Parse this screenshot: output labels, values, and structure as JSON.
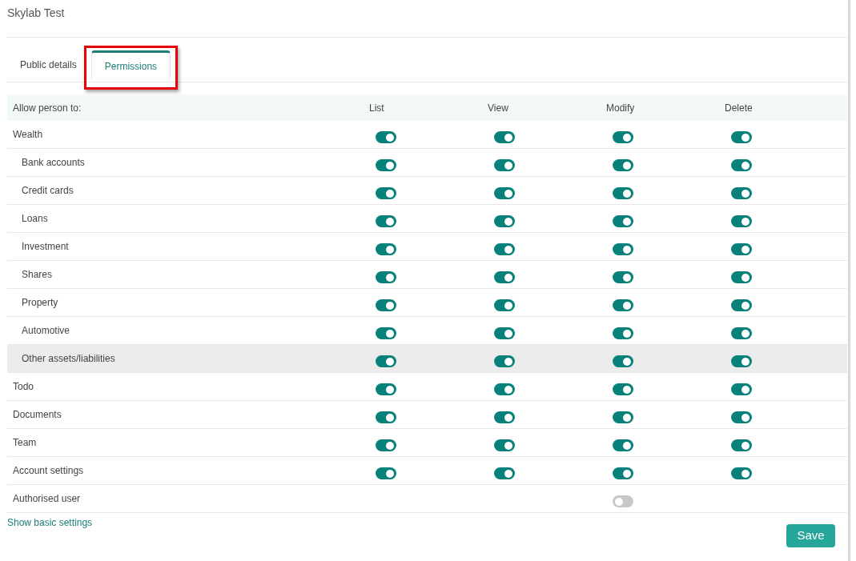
{
  "title": "Skylab Test",
  "tabs": [
    {
      "label": "Public details",
      "selected": false,
      "highlighted": false
    },
    {
      "label": "Permissions",
      "selected": true,
      "highlighted": true
    }
  ],
  "table": {
    "columns": [
      "Allow person to:",
      "List",
      "View",
      "Modify",
      "Delete"
    ],
    "rows": [
      {
        "label": "Wealth",
        "hovered": false,
        "toggles": {
          "list": {
            "on": true
          },
          "view": {
            "on": true
          },
          "modify": {
            "on": true
          },
          "delete": {
            "on": true
          }
        },
        "children": [
          {
            "label": "Bank accounts",
            "hovered": false,
            "toggles": {
              "list": {
                "on": true
              },
              "view": {
                "on": true
              },
              "modify": {
                "on": true
              },
              "delete": {
                "on": true
              }
            }
          },
          {
            "label": "Credit cards",
            "hovered": false,
            "toggles": {
              "list": {
                "on": true
              },
              "view": {
                "on": true
              },
              "modify": {
                "on": true
              },
              "delete": {
                "on": true
              }
            }
          },
          {
            "label": "Loans",
            "hovered": false,
            "toggles": {
              "list": {
                "on": true
              },
              "view": {
                "on": true
              },
              "modify": {
                "on": true
              },
              "delete": {
                "on": true
              }
            }
          },
          {
            "label": "Investment",
            "hovered": false,
            "toggles": {
              "list": {
                "on": true
              },
              "view": {
                "on": true
              },
              "modify": {
                "on": true
              },
              "delete": {
                "on": true
              }
            }
          },
          {
            "label": "Shares",
            "hovered": false,
            "toggles": {
              "list": {
                "on": true
              },
              "view": {
                "on": true
              },
              "modify": {
                "on": true
              },
              "delete": {
                "on": true
              }
            }
          },
          {
            "label": "Property",
            "hovered": false,
            "toggles": {
              "list": {
                "on": true
              },
              "view": {
                "on": true
              },
              "modify": {
                "on": true
              },
              "delete": {
                "on": true
              }
            }
          },
          {
            "label": "Automotive",
            "hovered": false,
            "toggles": {
              "list": {
                "on": true
              },
              "view": {
                "on": true
              },
              "modify": {
                "on": true
              },
              "delete": {
                "on": true
              }
            }
          },
          {
            "label": "Other assets/liabilities",
            "hovered": true,
            "toggles": {
              "list": {
                "on": true
              },
              "view": {
                "on": true
              },
              "modify": {
                "on": true
              },
              "delete": {
                "on": true
              }
            }
          }
        ]
      },
      {
        "label": "Todo",
        "hovered": false,
        "toggles": {
          "list": {
            "on": true
          },
          "view": {
            "on": true
          },
          "modify": {
            "on": true
          },
          "delete": {
            "on": true
          }
        }
      },
      {
        "label": "Documents",
        "hovered": false,
        "toggles": {
          "list": {
            "on": true
          },
          "view": {
            "on": true
          },
          "modify": {
            "on": true
          },
          "delete": {
            "on": true
          }
        }
      },
      {
        "label": "Team",
        "hovered": false,
        "toggles": {
          "list": {
            "on": true
          },
          "view": {
            "on": true
          },
          "modify": {
            "on": true
          },
          "delete": {
            "on": true
          }
        }
      },
      {
        "label": "Account settings",
        "hovered": false,
        "toggles": {
          "list": {
            "on": true
          },
          "view": {
            "on": true
          },
          "modify": {
            "on": true
          },
          "delete": {
            "on": true
          }
        }
      },
      {
        "label": "Authorised user",
        "hovered": false,
        "toggles": {
          "modify": {
            "on": false
          }
        }
      }
    ]
  },
  "link": "Show basic settings",
  "save_button": "Save"
}
